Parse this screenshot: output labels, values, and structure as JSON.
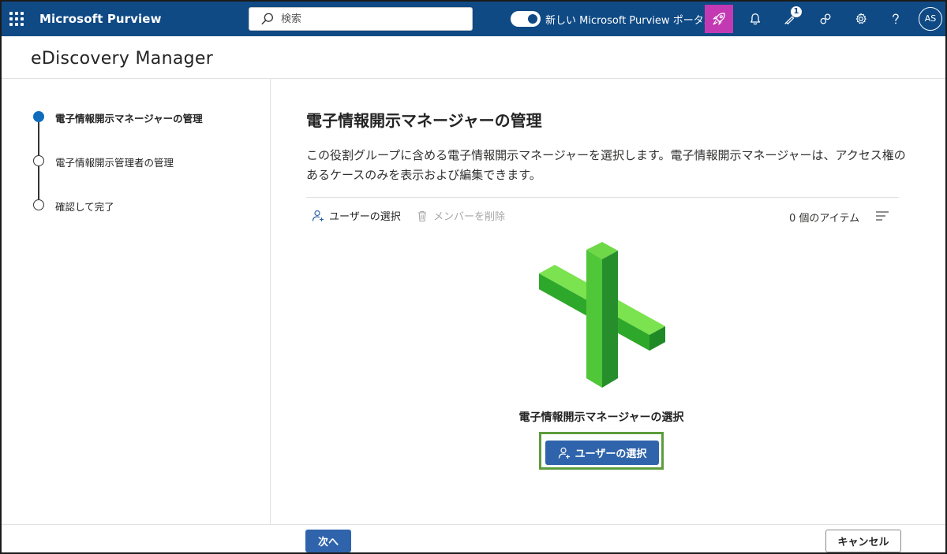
{
  "topbar": {
    "brand": "Microsoft Purview",
    "search_placeholder": "検索",
    "toggle_label": "新しい Microsoft Purview ポータル",
    "notification_badge": "1",
    "avatar_initials": "AS",
    "icons": [
      "app-launcher-icon",
      "search-icon",
      "rocket-icon",
      "bell-icon",
      "feedback-icon",
      "community-icon",
      "gear-icon",
      "help-icon"
    ]
  },
  "panel": {
    "title": "eDiscovery Manager"
  },
  "steps": [
    {
      "label": "電子情報開示マネージャーの管理",
      "state": "current"
    },
    {
      "label": "電子情報開示管理者の管理",
      "state": "pending"
    },
    {
      "label": "確認して完了",
      "state": "pending"
    }
  ],
  "main": {
    "heading": "電子情報開示マネージャーの管理",
    "description": "この役割グループに含める電子情報開示マネージャーを選択します。電子情報開示マネージャーは、アクセス権のあるケースのみを表示および編集できます。",
    "commands": {
      "select_users": "ユーザーの選択",
      "remove_members": "メンバーを削除"
    },
    "item_count": "0 個のアイテム",
    "empty_state": {
      "title": "電子情報開示マネージャーの選択",
      "button": "ユーザーの選択"
    }
  },
  "footer": {
    "next": "次へ",
    "cancel": "キャンセル"
  },
  "colors": {
    "topbar": "#0f4a85",
    "primary": "#2f64ac",
    "accent_rocket": "#c239b3",
    "step_active": "#0f6cbd",
    "highlight_box": "#5d9c3c",
    "illustration_green": "#4fc738"
  }
}
